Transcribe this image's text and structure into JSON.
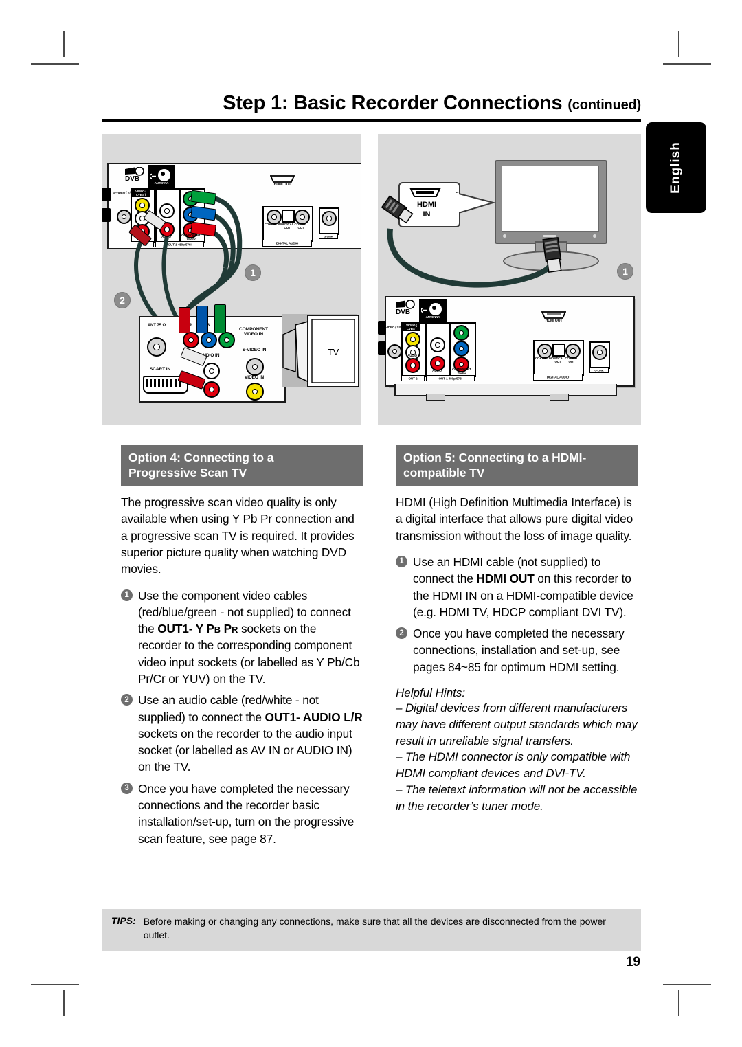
{
  "header": {
    "title": "Step 1: Basic Recorder Connections",
    "continued": "(continued)"
  },
  "side_tab": {
    "label": "English"
  },
  "diagrams": {
    "left": {
      "name": "progressive-scan-connection-diagram",
      "callouts": [
        "1",
        "2"
      ],
      "tv_label": "TV",
      "recorder_labels": {
        "dvb": "DVB",
        "antenna": "ANTENNA",
        "video_cvbs": "VIDEO ( CVBS )",
        "s_video": "S-VIDEO ( Y/C )",
        "audio": "AUDIO",
        "component_video": "COMPONENT VIDEO",
        "out2": "OUT 2",
        "out1": "OUT 1  480p/576i",
        "hdmi_out": "HDMI OUT",
        "coaxial_in": "COAXIAL IN",
        "optical_out": "OPTICAL OUT",
        "coaxial_out": "COAXIAL OUT",
        "digital_audio": "DIGITAL  AUDIO",
        "g_link": "G-LINK"
      },
      "tv_panel_labels": {
        "antenna": "ANT 75 Ω",
        "component_video_in": "COMPONENT VIDEO IN",
        "s_video_in": "S-VIDEO IN",
        "audio_in": "AUDIO IN",
        "video_in": "VIDEO IN",
        "scart_in": "SCART IN",
        "pr": "PR",
        "pb": "PB",
        "y": "Y"
      }
    },
    "right": {
      "name": "hdmi-connection-diagram",
      "callouts": [
        "1"
      ],
      "tv_callout": "HDMI\nIN",
      "tv_callout_line1": "HDMI",
      "tv_callout_line2": "IN",
      "recorder_labels": {
        "dvb": "DVB",
        "antenna": "ANTENNA",
        "video_cvbs": "VIDEO ( CVBS )",
        "s_video": "S-VIDEO ( Y/C )",
        "audio": "AUDIO",
        "component_video": "COMPONENT VIDEO",
        "out2": "OUT 2",
        "out1": "OUT 1  480p/576i",
        "hdmi_out": "HDMI OUT",
        "coaxial_in": "COAXIAL IN",
        "optical_out": "OPTICAL OUT",
        "coaxial_out": "COAXIAL OUT",
        "digital_audio": "DIGITAL  AUDIO",
        "g_link": "G-LINK"
      }
    }
  },
  "left_column": {
    "option_heading_line1": "Option 4: Connecting to a",
    "option_heading_line2": "Progressive Scan TV",
    "intro": "The progressive scan video quality is only available when using Y Pb Pr connection and a progressive scan TV is required. It provides superior picture quality when watching DVD movies.",
    "steps": [
      {
        "num": "1",
        "part1": "Use the component video cables (red/blue/green - not supplied) to connect the ",
        "bold1": "OUT1- Y P",
        "boldsub1": "B",
        "bold2": " P",
        "boldsub2": "R",
        "part2": " sockets on the recorder to the corresponding component video input sockets (or labelled as Y Pb/Cb Pr/Cr or YUV) on the TV."
      },
      {
        "num": "2",
        "part1": "Use an audio cable (red/white - not supplied) to connect the ",
        "bold1": "OUT1- AUDIO L/R",
        "part2": " sockets on the recorder to the audio input socket (or labelled as AV IN or AUDIO IN) on the TV."
      },
      {
        "num": "3",
        "part1": "Once you have completed the necessary connections and the recorder basic installation/set-up, turn on the progressive scan feature, see page 87."
      }
    ]
  },
  "right_column": {
    "option_heading_line1": "Option 5: Connecting to a HDMI-",
    "option_heading_line2": "compatible TV",
    "intro": "HDMI (High Definition Multimedia Interface) is a digital interface that allows pure digital video transmission without the loss of image quality.",
    "steps": [
      {
        "num": "1",
        "part1": "Use an HDMI cable (not supplied) to connect the ",
        "bold1": "HDMI OUT",
        "part2": " on this recorder to the HDMI IN on a HDMI-compatible device (e.g. HDMI TV, HDCP compliant DVI TV)."
      },
      {
        "num": "2",
        "part1": "Once you have completed the necessary connections, installation and set-up, see pages 84~85 for optimum HDMI setting."
      }
    ],
    "hints_title": "Helpful Hints:",
    "hints": [
      "– Digital devices from different manufacturers may have different output standards which may result in unreliable signal transfers.",
      "– The HDMI connector is only compatible with HDMI compliant devices and DVI-TV.",
      "– The teletext information will not be accessible in the recorder’s tuner mode."
    ]
  },
  "tips": {
    "label": "TIPS:",
    "text": "Before making or changing any connections, make sure that all the devices are disconnected from the power outlet."
  },
  "page_number": "19",
  "colors": {
    "heading_bg": "#6e6e6e",
    "diagram_bg": "#dadada",
    "tips_bg": "#d8d8d8",
    "cable_red": "#e3000f",
    "cable_blue": "#0066c0",
    "cable_green": "#00a03c",
    "cable_sheath": "#203a36",
    "jack_yellow": "#f5e400"
  }
}
